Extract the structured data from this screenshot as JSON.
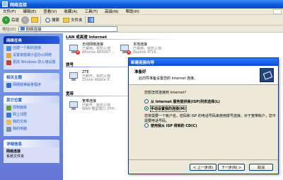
{
  "window": {
    "title": "网络连接"
  },
  "menu": [
    "文件(F)",
    "编辑(E)",
    "查看(V)",
    "收藏(A)",
    "工具(T)",
    "高级(N)",
    "帮助(H)"
  ],
  "toolbar": {
    "back": "后退",
    "search": "搜索",
    "folders": "文件夹"
  },
  "address": {
    "label": "地址(D)",
    "value": "网络连接"
  },
  "left_pane": {
    "panels": [
      {
        "title": "网络任务",
        "items": [
          "创建一个新的连接",
          "设置家庭或小型办公网络",
          "更改 Windows 防火墙设置"
        ]
      },
      {
        "title": "相关主题",
        "items": [
          "网络疑难解答程序"
        ]
      },
      {
        "title": "其它位置",
        "items": [
          "控制面板",
          "网上邻居",
          "我的文档",
          "我的电脑"
        ]
      },
      {
        "title": "详细信息",
        "items": [
          "网络连接",
          "系统文件夹"
        ]
      }
    ]
  },
  "main": {
    "groups": [
      "LAN 或高速 Internet",
      "拨号",
      "宽带"
    ],
    "connections": [
      {
        "name": "无线网络连接",
        "status": "已禁用，有防火墙",
        "device": "Atheros AR5007 ..."
      },
      {
        "name": "本地连接",
        "status": "已禁用，有防火墙",
        "device": "Realtek RTL8..."
      },
      {
        "name": "ZTE",
        "status": "已断开，有防火墙",
        "device": "Zhone Mobile P..."
      },
      {
        "name": "宽带连接",
        "status": "已断开，有防火墙",
        "device": "WAN 微型端口 (PPP..."
      }
    ]
  },
  "dialog": {
    "title": "新建连接向导",
    "header_title": "准备好",
    "header_subtitle": "此向导准备设置您的 Internet 连接。",
    "question": "您想怎样连接到 Internet?",
    "options": [
      {
        "label": "从 Internet 服务提供商(ISP)列表选择(L)",
        "desc": ""
      },
      {
        "label": "手动设置我的连接(M)",
        "desc": "您将需要一个帐户名，密码和 ISP 的电话号码来使用拨号连接。对于宽带帐户，您不需要电话号码。"
      },
      {
        "label": "使用我从 ISP 得到的 CD(C)",
        "desc": ""
      }
    ],
    "selected_index": 1,
    "buttons": {
      "back": "< 上一步(B)",
      "next": "下一步(N) >",
      "cancel": "取消"
    }
  }
}
